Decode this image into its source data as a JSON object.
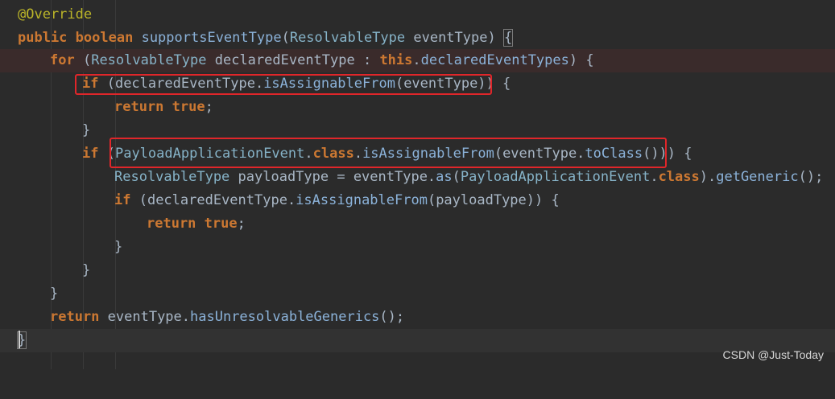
{
  "lines": [
    {
      "annotation": "@Override"
    },
    {
      "kw1": "public",
      "kw2": "boolean",
      "method": "supportsEventType",
      "open": "(",
      "type": "ResolvableType",
      "param": " eventType",
      "close": ") ",
      "brace": "{"
    },
    {
      "kw": "for",
      "open": " (",
      "type": "ResolvableType",
      "var": " declaredEventType : ",
      "kw_this": "this",
      "dot": ".",
      "field": "declaredEventTypes",
      "close": ") {"
    },
    {
      "kw": "if",
      "open": " (declaredEventType.",
      "method": "isAssignableFrom",
      "args": "(eventType))",
      "close": " {"
    },
    {
      "kw1": "return",
      "kw2": "true",
      "semi": ";"
    },
    {
      "brace": "}"
    },
    {
      "kw": "if",
      "open": " (",
      "type": "PayloadApplicationEvent",
      "dot1": ".",
      "kw_class": "class",
      "dot2": ".",
      "method": "isAssignableFrom",
      "args_open": "(eventType.",
      "method2": "toClass",
      "args_close": "()))",
      "close": " {"
    },
    {
      "type": "ResolvableType",
      "mid": " payloadType = eventType.",
      "method": "as",
      "open": "(",
      "type2": "PayloadApplicationEvent",
      "dot": ".",
      "kw_class": "class",
      "close1": ").",
      "method2": "getGeneric",
      "close2": "();"
    },
    {
      "kw": "if",
      "open": " (declaredEventType.",
      "method": "isAssignableFrom",
      "args": "(payloadType))",
      "close": " {"
    },
    {
      "kw1": "return",
      "kw2": "true",
      "semi": ";"
    },
    {
      "brace": "}"
    },
    {
      "brace": "}"
    },
    {
      "brace": "}"
    },
    {
      "kw": "return",
      "mid": " eventType.",
      "method": "hasUnresolvableGenerics",
      "close": "();"
    },
    {
      "brace": "}"
    }
  ],
  "watermark": "CSDN @Just-Today",
  "colors": {
    "background": "#2b2b2b",
    "keyword": "#cc7832",
    "annotation": "#bbb529",
    "method": "#8bb2d9",
    "type": "#86b3c8",
    "text": "#a9b7c6",
    "highlight_box": "#e0262a"
  }
}
